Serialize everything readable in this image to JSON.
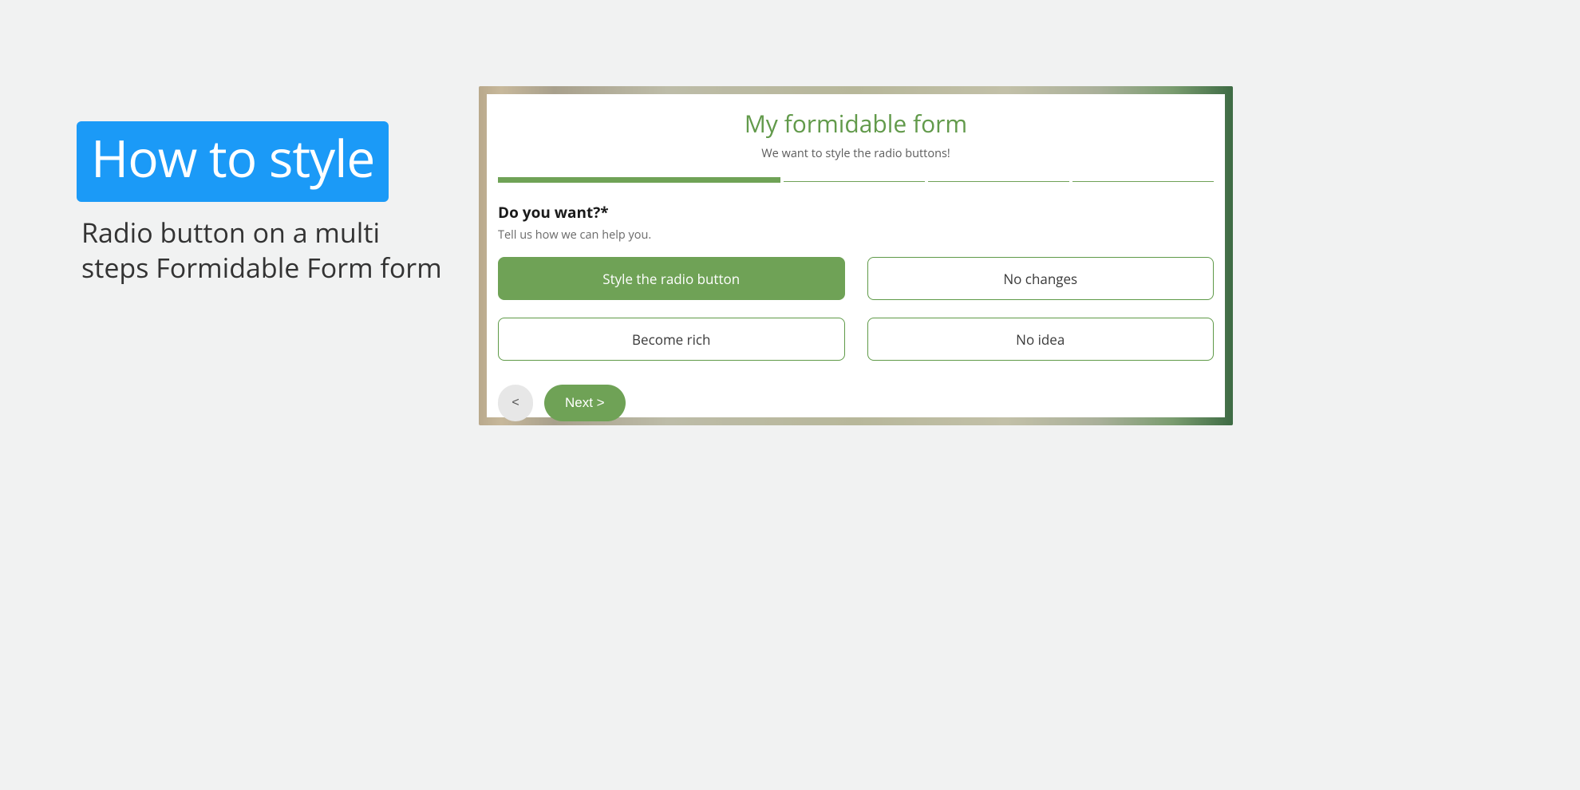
{
  "left": {
    "badge": "How to style",
    "subtitle": "Radio button on a multi steps Formidable Form form"
  },
  "form": {
    "title": "My formidable form",
    "description": "We want to style the radio buttons!",
    "progress": {
      "total_steps": 4,
      "current_step": 1
    },
    "question": {
      "label": "Do you want?*",
      "help": "Tell us how we can help you.",
      "options": [
        {
          "label": "Style the radio button",
          "selected": true
        },
        {
          "label": "No changes",
          "selected": false
        },
        {
          "label": "Become rich",
          "selected": false
        },
        {
          "label": "No idea",
          "selected": false
        }
      ]
    },
    "nav": {
      "prev": "<",
      "next": "Next >"
    }
  },
  "colors": {
    "accent_blue": "#1b9af7",
    "form_green": "#6fa256",
    "border_green": "#5f9a48"
  }
}
